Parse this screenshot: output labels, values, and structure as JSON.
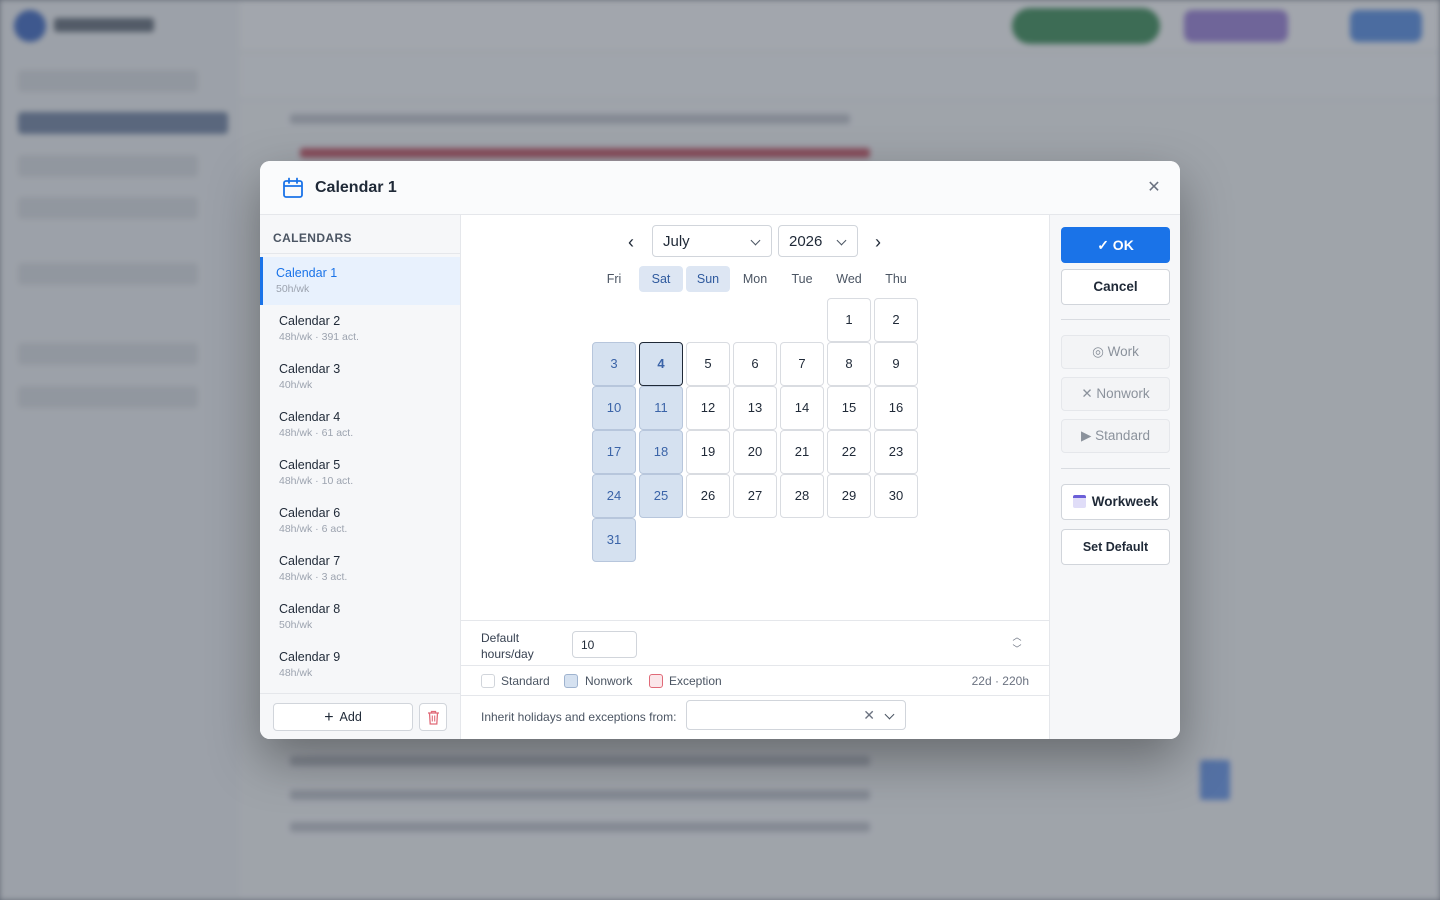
{
  "dialog": {
    "title": "Calendar 1",
    "close_glyph": "✕"
  },
  "calendars": {
    "heading": "CALENDARS",
    "items": [
      {
        "name": "Calendar 1",
        "sub": "50h/wk"
      },
      {
        "name": "Calendar 2",
        "sub": "48h/wk · 391 act."
      },
      {
        "name": "Calendar 3",
        "sub": "40h/wk"
      },
      {
        "name": "Calendar 4",
        "sub": "48h/wk · 61 act."
      },
      {
        "name": "Calendar 5",
        "sub": "48h/wk · 10 act."
      },
      {
        "name": "Calendar 6",
        "sub": "48h/wk · 6 act."
      },
      {
        "name": "Calendar 7",
        "sub": "48h/wk · 3 act."
      },
      {
        "name": "Calendar 8",
        "sub": "50h/wk"
      },
      {
        "name": "Calendar 9",
        "sub": "48h/wk"
      }
    ],
    "selected_index": 0,
    "add_label": "Add",
    "add_glyph": "+"
  },
  "month_view": {
    "prev_glyph": "‹",
    "next_glyph": "›",
    "month": "July",
    "year": "2026",
    "weekdays": [
      "Fri",
      "Sat",
      "Sun",
      "Mon",
      "Tue",
      "Wed",
      "Thu"
    ],
    "weekend_columns": [
      1,
      2
    ],
    "first_day_column": 5,
    "days_in_month": 31,
    "today": 4,
    "nonwork_days": [
      3,
      4,
      10,
      11,
      17,
      18,
      24,
      25,
      31
    ]
  },
  "hours": {
    "label": "Default hours/day",
    "value": "10",
    "up_glyph": "︿",
    "down_glyph": "﹀"
  },
  "legend": {
    "standard": "Standard",
    "nonwork": "Nonwork",
    "exception": "Exception",
    "summary": "22d · 220h"
  },
  "inherit": {
    "label": "Inherit holidays and exceptions from:",
    "value": "",
    "clear_glyph": "✕"
  },
  "actions": {
    "ok": "✓ OK",
    "cancel": "Cancel",
    "work": "◎ Work",
    "nonwork": "✕ Nonwork",
    "standard": "▶ Standard",
    "workweek": "Workweek",
    "set_default": "Set Default"
  },
  "colors": {
    "accent": "#1a73e8",
    "nonwork_fill": "#d5e1f0",
    "exception_border": "#e06a78"
  }
}
